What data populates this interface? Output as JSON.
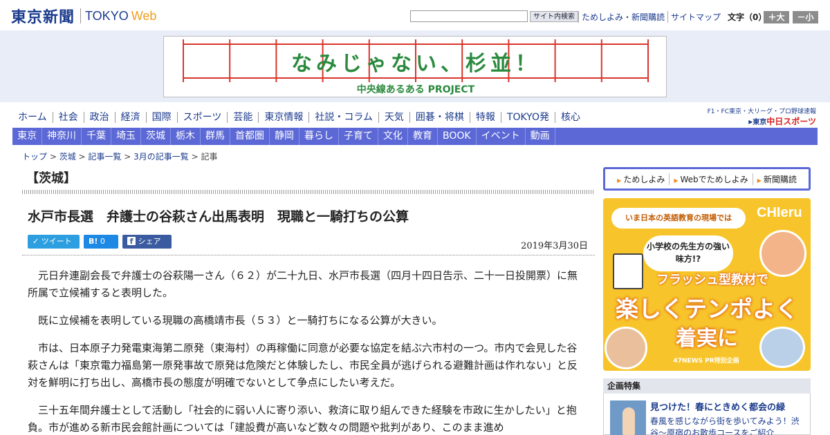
{
  "header": {
    "logo_jp": "東京新聞",
    "logo_en": "TOKYO",
    "logo_web": "Web",
    "search_button": "サイト内検索",
    "search_value": "",
    "links": [
      "ためしよみ・新聞購読",
      "サイトマップ"
    ],
    "font_size_label": "文字（0）",
    "zoom_in": "＋大",
    "zoom_out": "－小"
  },
  "banner": {
    "main": "なみじゃない、杉並！",
    "sub": "中央線あるある PROJECT",
    "color": "#2b8a3e",
    "grid_color": "#d9342b"
  },
  "nav_main": [
    "ホーム",
    "社会",
    "政治",
    "経済",
    "国際",
    "スポーツ",
    "芸能",
    "東京情報",
    "社説・コラム",
    "天気",
    "囲碁・将棋",
    "特報",
    "TOKYO発",
    "核心"
  ],
  "chunichi": {
    "line1": "F1・FC東京・大リーグ・プロ野球速報",
    "prefix": "東京",
    "name": "中日スポーツ"
  },
  "nav_region": [
    "東京",
    "神奈川",
    "千葉",
    "埼玉",
    "茨城",
    "栃木",
    "群馬",
    "首都圏",
    "静岡",
    "暮らし",
    "子育て",
    "文化",
    "教育",
    "BOOK",
    "イベント",
    "動画"
  ],
  "breadcrumb": {
    "items": [
      "トップ",
      "茨城",
      "記事一覧",
      "3月の記事一覧"
    ],
    "current": "記事",
    "separator": " > "
  },
  "article": {
    "region": "【茨城】",
    "title": "水戸市長選　弁護士の谷萩さん出馬表明　現職と一騎打ちの公算",
    "date": "2019年3月30日",
    "share": {
      "tweet": "ツイート",
      "hatena_count": "0",
      "facebook": "シェア 0"
    },
    "paragraphs": [
      "元日弁連副会長で弁護士の谷萩陽一さん（６２）が二十九日、水戸市長選（四月十四日告示、二十一日投開票）に無所属で立候補すると表明した。",
      "既に立候補を表明している現職の高橋靖市長（５３）と一騎打ちになる公算が大きい。",
      "市は、日本原子力発電東海第二原発（東海村）の再稼働に同意が必要な協定を結ぶ六市村の一つ。市内で会見した谷萩さんは「東京電力福島第一原発事故で原発は危険だと体験したし、市民全員が逃げられる避難計画は作れない」と反対を鮮明に打ち出し、高橋市長の態度が明確でないとして争点にしたい考えだ。",
      "三十五年間弁護士として活動し「社会的に弱い人に寄り添い、救済に取り組んできた経験を市政に生かしたい」と抱負。市が進める新市民会館計画については「建設費が高いなど数々の問題や批判があり、このまま進め"
    ]
  },
  "promo_links": [
    "ためしよみ",
    "Webでためしよみ",
    "新聞購読"
  ],
  "ad": {
    "top": "いま日本の英語教育の現場では",
    "brand": "CHIeru",
    "bubble": "小学校の先生方の強い味方!?",
    "line1": "フラッシュ型教材で",
    "line2": "楽しくテンポよく",
    "line3": "着実に",
    "footer": "47NEWS PR特別企画",
    "bg_color": "#f7c52b",
    "accent_color": "#e0621a"
  },
  "feature": {
    "heading": "企画特集",
    "title": "見つけた！春にときめく都会の緑",
    "desc": "春風を感じながら街を歩いてみよう！渋谷～原宿のお散歩コースをご紹介"
  }
}
